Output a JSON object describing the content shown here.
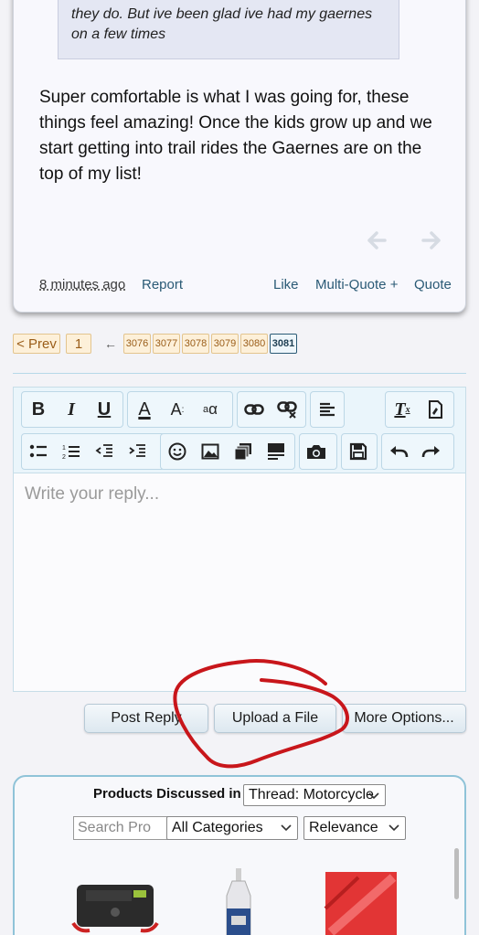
{
  "post": {
    "quote_text": "they do. But ive been glad ive had my gaernes on a few times",
    "body": "Super comfortable is what I was going for, these things feel amazing! Once the kids grow up and we start getting into trail rides the Gaernes are on the top of my list!",
    "time": "8 minutes ago",
    "report": "Report",
    "like": "Like",
    "multi_quote": "Multi-Quote +",
    "quote": "Quote"
  },
  "pagination": {
    "prev": "< Prev",
    "first": "1",
    "arrow": "←",
    "pages": [
      "3076",
      "3077",
      "3078",
      "3079",
      "3080"
    ],
    "current": "3081"
  },
  "editor": {
    "placeholder": "Write your reply...",
    "toolbar_row1": [
      {
        "label": "B",
        "name": "bold-icon"
      },
      {
        "label": "I",
        "name": "italic-icon"
      },
      {
        "label": "U",
        "name": "underline-icon"
      },
      {
        "label": "A",
        "name": "text-color-icon"
      },
      {
        "label": "A",
        "name": "font-size-icon"
      },
      {
        "label": "aα",
        "name": "font-family-icon"
      },
      {
        "label": "link",
        "name": "link-icon"
      },
      {
        "label": "unlink",
        "name": "unlink-icon"
      },
      {
        "label": "align",
        "name": "align-icon"
      },
      {
        "label": "Tx",
        "name": "remove-format-icon"
      },
      {
        "label": "bbcode",
        "name": "toggle-bbcode-icon"
      }
    ],
    "toolbar_row2": [
      "bullet-list-icon",
      "numbered-list-icon",
      "outdent-icon",
      "indent-icon",
      "smiley-icon",
      "image-icon",
      "media-icon",
      "quote-block-icon",
      "camera-icon",
      "save-draft-icon",
      "undo-icon",
      "redo-icon"
    ]
  },
  "actions": {
    "post_reply": "Post Reply",
    "upload": "Upload a File",
    "more_options": "More Options..."
  },
  "products": {
    "title": "Products Discussed in",
    "thread_select": "Thread: Motorcycle",
    "search_placeholder": "Search Pro",
    "category_select": "All Categories",
    "sort_select": "Relevance"
  },
  "colors": {
    "link": "#2a5a75",
    "page_bg": "#f3f3f7",
    "annotation": "#c8161b"
  }
}
